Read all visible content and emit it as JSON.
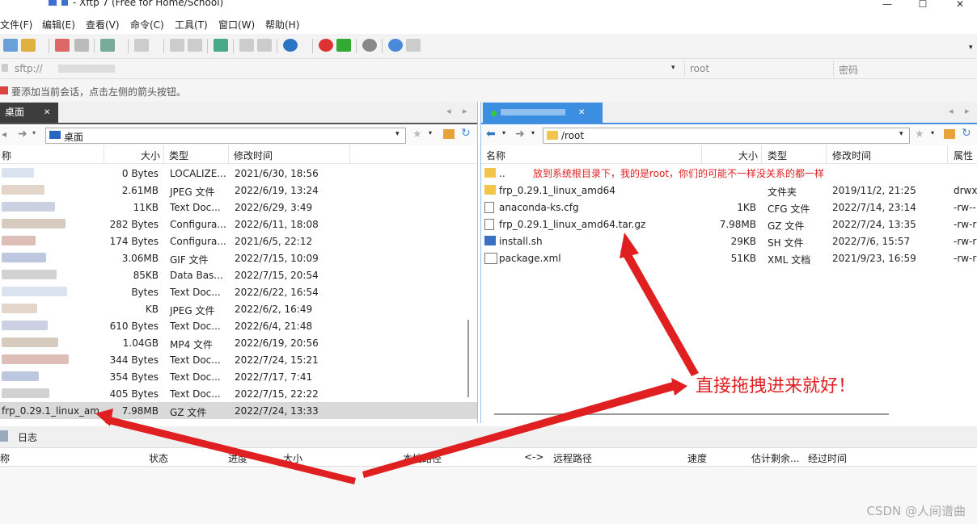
{
  "title": "- Xftp 7 (Free for Home/School)",
  "window_controls": [
    "—",
    "☐",
    "✕"
  ],
  "menu": [
    "文件(F)",
    "编辑(E)",
    "查看(V)",
    "命令(C)",
    "工具(T)",
    "窗口(W)",
    "帮助(H)"
  ],
  "address": {
    "value": "sftp://",
    "user": "root",
    "password": "密码"
  },
  "hint": "要添加当前会话，点击左侧的箭头按钮。",
  "left": {
    "tab": "桌面",
    "path": "桌面",
    "headers": {
      "name": "称",
      "size": "大小",
      "type": "类型",
      "modified": "修改时间"
    },
    "rows": [
      {
        "size": "0 Bytes",
        "type": "LOCALIZE...",
        "modified": "2021/6/30, 18:56"
      },
      {
        "size": "2.61MB",
        "type": "JPEG 文件",
        "modified": "2022/6/19, 13:24"
      },
      {
        "size": "11KB",
        "type": "Text Doc...",
        "modified": "2022/6/29, 3:49"
      },
      {
        "size": "282 Bytes",
        "type": "Configura...",
        "modified": "2022/6/11, 18:08"
      },
      {
        "size": "174 Bytes",
        "type": "Configura...",
        "modified": "2021/6/5, 22:12"
      },
      {
        "size": "3.06MB",
        "type": "GIF 文件",
        "modified": "2022/7/15, 10:09"
      },
      {
        "size": "85KB",
        "type": "Data Bas...",
        "modified": "2022/7/15, 20:54"
      },
      {
        "size": "Bytes",
        "type": "Text Doc...",
        "modified": "2022/6/22, 16:54"
      },
      {
        "size": "KB",
        "type": "JPEG 文件",
        "modified": "2022/6/2, 16:49"
      },
      {
        "size": "610 Bytes",
        "type": "Text Doc...",
        "modified": "2022/6/4, 21:48"
      },
      {
        "size": "1.04GB",
        "type": "MP4 文件",
        "modified": "2022/6/19, 20:56"
      },
      {
        "size": "344 Bytes",
        "type": "Text Doc...",
        "modified": "2022/7/24, 15:21"
      },
      {
        "size": "354 Bytes",
        "type": "Text Doc...",
        "modified": "2022/7/17, 7:41"
      },
      {
        "size": "405 Bytes",
        "type": "Text Doc...",
        "modified": "2022/7/15, 22:22"
      },
      {
        "name": "frp_0.29.1_linux_am...",
        "size": "7.98MB",
        "type": "GZ 文件",
        "modified": "2022/7/24, 13:33"
      }
    ]
  },
  "right": {
    "path": "/root",
    "headers": {
      "name": "名称",
      "size": "大小",
      "type": "类型",
      "modified": "修改时间",
      "attr": "属性"
    },
    "rows": [
      {
        "name": "..",
        "size": "",
        "type": "",
        "modified": "",
        "attr": ""
      },
      {
        "name": "frp_0.29.1_linux_amd64",
        "size": "",
        "type": "文件夹",
        "modified": "2019/11/2, 21:25",
        "attr": "drwx"
      },
      {
        "name": "anaconda-ks.cfg",
        "size": "1KB",
        "type": "CFG 文件",
        "modified": "2022/7/14, 23:14",
        "attr": "-rw--"
      },
      {
        "name": "frp_0.29.1_linux_amd64.tar.gz",
        "size": "7.98MB",
        "type": "GZ 文件",
        "modified": "2022/7/24, 13:35",
        "attr": "-rw-r"
      },
      {
        "name": "install.sh",
        "size": "29KB",
        "type": "SH 文件",
        "modified": "2022/7/6, 15:57",
        "attr": "-rw-r"
      },
      {
        "name": "package.xml",
        "size": "51KB",
        "type": "XML 文档",
        "modified": "2021/9/23, 16:59",
        "attr": "-rw-r"
      }
    ]
  },
  "log": {
    "tab": "日志",
    "headers": [
      "称",
      "状态",
      "进度",
      "大小",
      "本地路径",
      "<->",
      "远程路径",
      "速度",
      "估计剩余...",
      "经过时间"
    ]
  },
  "annotations": {
    "top": "放到系统根目录下，我的是root，你们的可能不一样没关系的都一样",
    "center": "直接拖拽进来就好！"
  },
  "watermark": "CSDN @人间谱曲"
}
